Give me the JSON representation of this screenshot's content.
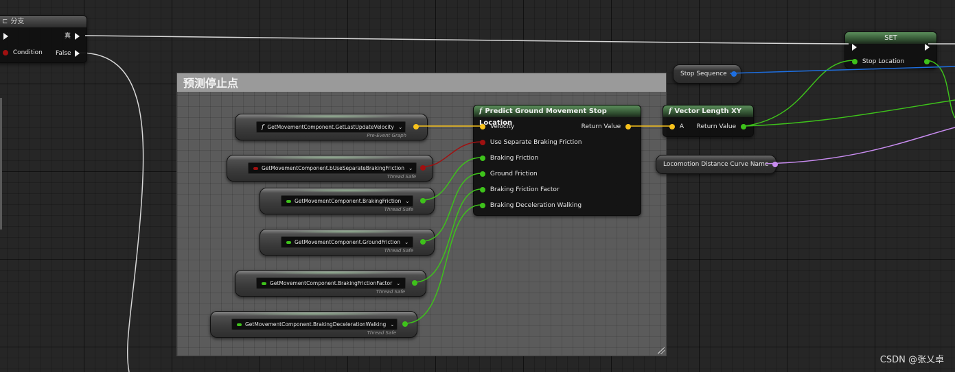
{
  "colors": {
    "exec": "#ffffff",
    "bool": "#8b0000",
    "float": "#3ec21b",
    "vector": "#f7c21c",
    "struct_seq": "#1e6fe0",
    "name": "#c88cf0",
    "header_pure": "#3d6b3d"
  },
  "branch_node": {
    "title": "分支",
    "icon": "branch-icon",
    "true_label": "真",
    "condition_label": "Condition",
    "false_label": "False"
  },
  "comment_box": {
    "title": "预测停止点"
  },
  "getters": [
    {
      "label": "GetMovementComponent.GetLastUpdateVelocity",
      "subtitle": "Pre-Event Graph",
      "type": "vector",
      "icon": "function-icon"
    },
    {
      "label": "GetMovementComponent.bUseSeparateBrakingFriction",
      "subtitle": "Thread Safe",
      "type": "bool",
      "icon": "bool-pin-icon"
    },
    {
      "label": "GetMovementComponent.BrakingFriction",
      "subtitle": "Thread Safe",
      "type": "float",
      "icon": "float-pin-icon"
    },
    {
      "label": "GetMovementComponent.GroundFriction",
      "subtitle": "Thread Safe",
      "type": "float",
      "icon": "float-pin-icon"
    },
    {
      "label": "GetMovementComponent.BrakingFrictionFactor",
      "subtitle": "Thread Safe",
      "type": "float",
      "icon": "float-pin-icon"
    },
    {
      "label": "GetMovementComponent.BrakingDecelerationWalking",
      "subtitle": "Thread Safe",
      "type": "float",
      "icon": "float-pin-icon"
    }
  ],
  "predict_node": {
    "title": "Predict Ground Movement Stop Location",
    "inputs": [
      "Velocity",
      "Use Separate Braking Friction",
      "Braking Friction",
      "Ground Friction",
      "Braking Friction Factor",
      "Braking Deceleration Walking"
    ],
    "output": "Return Value"
  },
  "vector_length_node": {
    "title": "Vector Length XY",
    "input": "A",
    "output": "Return Value"
  },
  "set_node": {
    "title": "SET",
    "variable": "Stop Location"
  },
  "stop_sequence": {
    "label": "Stop Sequence"
  },
  "curve_name": {
    "label": "Locomotion Distance Curve Name"
  },
  "watermark": "CSDN @张乂卓"
}
